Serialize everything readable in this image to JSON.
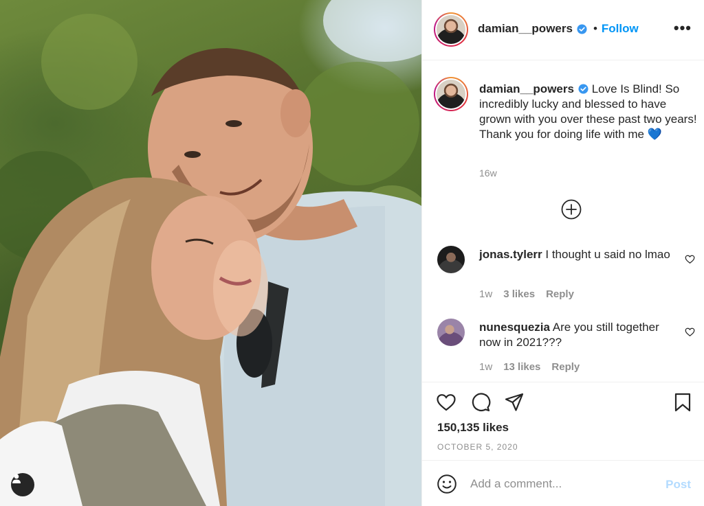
{
  "post": {
    "username": "damian__powers",
    "follow_label": "Follow",
    "separator": "•",
    "more_label": "•••",
    "caption": "Love Is Blind! So incredibly lucky and blessed to have grown with you over these past two years! Thank you for doing life with me 💙",
    "caption_age": "16w"
  },
  "comments": [
    {
      "username": "jonas.tylerr",
      "text": "I thought u said no lmao",
      "age": "1w",
      "likes": "3 likes",
      "reply": "Reply"
    },
    {
      "username": "nunesquezia",
      "text": "Are you still together now in 2021???",
      "age": "1w",
      "likes": "13 likes",
      "reply": "Reply"
    }
  ],
  "engagement": {
    "likes": "150,135 likes",
    "date": "OCTOBER 5, 2020"
  },
  "composer": {
    "placeholder": "Add a comment...",
    "post_label": "Post"
  },
  "icons": {
    "verified": "verified-badge-icon",
    "load_more": "plus-circle-icon",
    "like": "heart-icon",
    "comment": "comment-bubble-icon",
    "share": "paper-plane-icon",
    "save": "bookmark-icon",
    "emoji": "smiley-icon",
    "tagged_user": "user-silhouette-icon"
  },
  "colors": {
    "accent": "#0095f6",
    "verified": "#3897f0",
    "post_disabled": "#b3dbff",
    "muted": "#8e8e8e"
  }
}
